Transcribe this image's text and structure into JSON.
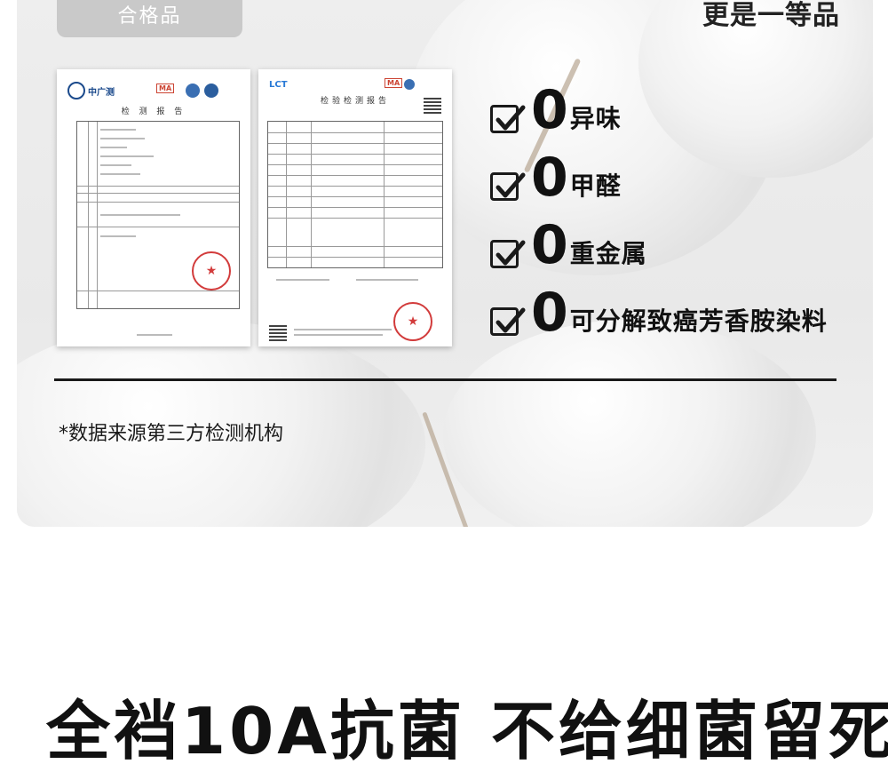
{
  "badge": {
    "label": "合格品"
  },
  "top_right_text": "更是一等品",
  "report1": {
    "brand": "中广测",
    "title": "检 测 报 告",
    "mark": "MA"
  },
  "report2": {
    "brand": "LCT",
    "title": "检验检测报告",
    "mark": "MA"
  },
  "claims": [
    {
      "zero": "0",
      "text": "异味"
    },
    {
      "zero": "0",
      "text": "甲醛"
    },
    {
      "zero": "0",
      "text": "重金属"
    },
    {
      "zero": "0",
      "text": "可分解致癌芳香胺染料"
    }
  ],
  "source_note": "*数据来源第三方检测机构",
  "bottom_title": "全裆10A抗菌 不给细菌留死"
}
